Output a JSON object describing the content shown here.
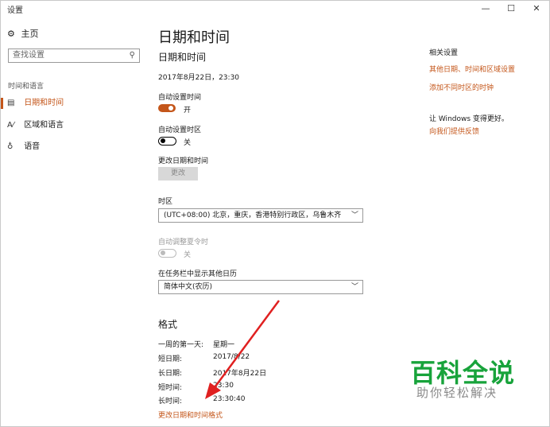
{
  "window": {
    "title": "设置",
    "minimize": "—",
    "maximize": "☐",
    "close": "✕"
  },
  "sidebar": {
    "home_label": "主页",
    "search_placeholder": "查找设置",
    "section_label": "时间和语言",
    "items": [
      {
        "label": "日期和时间",
        "icon": "calendar-clock-icon",
        "active": true
      },
      {
        "label": "区域和语言",
        "icon": "region-language-icon",
        "active": false
      },
      {
        "label": "语音",
        "icon": "microphone-icon",
        "active": false
      }
    ]
  },
  "main": {
    "page_title": "日期和时间",
    "section_title": "日期和时间",
    "current_datetime": "2017年8月22日，23:30",
    "auto_time": {
      "label": "自动设置时间",
      "state": "开",
      "on": true
    },
    "auto_timezone": {
      "label": "自动设置时区",
      "state": "关",
      "on": false
    },
    "change_datetime": {
      "label": "更改日期和时间",
      "button": "更改"
    },
    "timezone": {
      "label": "时区",
      "value": "(UTC+08:00) 北京，重庆，香港特别行政区，乌鲁木齐"
    },
    "dst": {
      "label": "自动调整夏令时",
      "state": "关",
      "enabled": false
    },
    "calendar": {
      "label": "在任务栏中显示其他日历",
      "value": "简体中文(农历)"
    },
    "formats": {
      "title": "格式",
      "rows": [
        {
          "key": "一周的第一天:",
          "value": "星期一"
        },
        {
          "key": "短日期:",
          "value": "2017/8/22"
        },
        {
          "key": "长日期:",
          "value": "2017年8月22日"
        },
        {
          "key": "短时间:",
          "value": "23:30"
        },
        {
          "key": "长时间:",
          "value": "23:30:40"
        }
      ],
      "change_link": "更改日期和时间格式"
    }
  },
  "related": {
    "title": "相关设置",
    "links": [
      "其他日期、时间和区域设置",
      "添加不同时区的时钟"
    ],
    "feedback_prompt": "让 Windows 变得更好。",
    "feedback_link": "向我们提供反馈"
  },
  "watermark": {
    "logo": "百科全说",
    "subtitle": "助你轻松解决"
  },
  "colors": {
    "accent": "#c4561a",
    "watermark_green": "#18a33b",
    "arrow": "#e02020"
  }
}
